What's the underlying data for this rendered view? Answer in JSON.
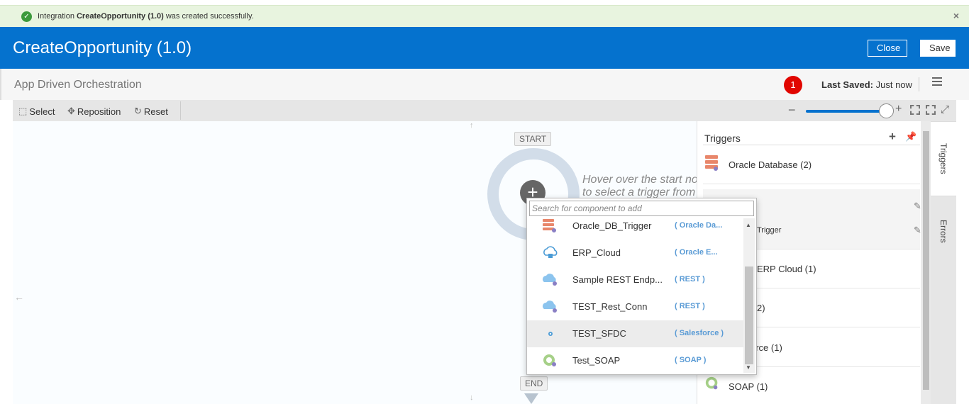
{
  "notification": {
    "prefix": "Integration",
    "name": "CreateOpportunity (1.0)",
    "suffix": "was created successfully.",
    "close": "×"
  },
  "header": {
    "title": "CreateOpportunity (1.0)",
    "close_label": "Close",
    "save_label": "Save"
  },
  "subheader": {
    "pattern": "App Driven Orchestration",
    "badge_count": "1",
    "last_saved_label": "Last Saved:",
    "last_saved_value": "Just now"
  },
  "toolbar": {
    "select": "Select",
    "reposition": "Reposition",
    "reset": "Reset",
    "zoom_level": 0.92
  },
  "canvas": {
    "start_label": "START",
    "end_label": "END",
    "hint_line1": "Hover over the start no",
    "hint_line2": "to select a trigger from"
  },
  "dropdown": {
    "placeholder": "Search for component to add",
    "items": [
      {
        "name": "Oracle_DB_Trigger",
        "type": "( Oracle Da...",
        "icon": "database-icon"
      },
      {
        "name": "ERP_Cloud",
        "type": "( Oracle E...",
        "icon": "erp-cloud-icon"
      },
      {
        "name": "Sample REST Endp...",
        "type": "( REST )",
        "icon": "rest-cloud-icon"
      },
      {
        "name": "TEST_Rest_Conn",
        "type": "( REST )",
        "icon": "rest-cloud-icon"
      },
      {
        "name": "TEST_SFDC",
        "type": "( Salesforce )",
        "icon": "salesforce-icon"
      },
      {
        "name": "Test_SOAP",
        "type": "( SOAP )",
        "icon": "soap-icon"
      }
    ]
  },
  "panel": {
    "title": "Triggers",
    "items": [
      {
        "label": "Oracle Database (2)"
      },
      {
        "label": "Trigger"
      },
      {
        "label": "ERP Cloud (1)"
      },
      {
        "label": "2)"
      },
      {
        "label": "orce (1)"
      },
      {
        "label": "SOAP (1)"
      }
    ]
  },
  "tabs": {
    "triggers": "Triggers",
    "errors": "Errors"
  },
  "colors": {
    "brand": "#0572ce",
    "success_bg": "#e8f4df",
    "badge": "#e10600",
    "type_text": "#5a9bd5"
  }
}
